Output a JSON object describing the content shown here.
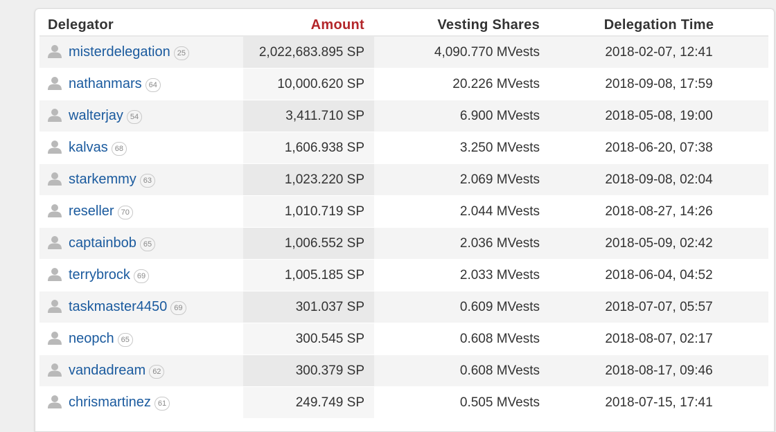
{
  "table": {
    "headers": {
      "delegator": "Delegator",
      "amount": "Amount",
      "vesting_shares": "Vesting Shares",
      "delegation_time": "Delegation Time"
    },
    "rows": [
      {
        "delegator": "misterdelegation",
        "rep": "25",
        "amount": "2,022,683.895 SP",
        "vesting": "4,090.770 MVests",
        "time": "2018-02-07, 12:41"
      },
      {
        "delegator": "nathanmars",
        "rep": "64",
        "amount": "10,000.620 SP",
        "vesting": "20.226 MVests",
        "time": "2018-09-08, 17:59"
      },
      {
        "delegator": "walterjay",
        "rep": "54",
        "amount": "3,411.710 SP",
        "vesting": "6.900 MVests",
        "time": "2018-05-08, 19:00"
      },
      {
        "delegator": "kalvas",
        "rep": "68",
        "amount": "1,606.938 SP",
        "vesting": "3.250 MVests",
        "time": "2018-06-20, 07:38"
      },
      {
        "delegator": "starkemmy",
        "rep": "63",
        "amount": "1,023.220 SP",
        "vesting": "2.069 MVests",
        "time": "2018-09-08, 02:04"
      },
      {
        "delegator": "reseller",
        "rep": "70",
        "amount": "1,010.719 SP",
        "vesting": "2.044 MVests",
        "time": "2018-08-27, 14:26"
      },
      {
        "delegator": "captainbob",
        "rep": "65",
        "amount": "1,006.552 SP",
        "vesting": "2.036 MVests",
        "time": "2018-05-09, 02:42"
      },
      {
        "delegator": "terrybrock",
        "rep": "69",
        "amount": "1,005.185 SP",
        "vesting": "2.033 MVests",
        "time": "2018-06-04, 04:52"
      },
      {
        "delegator": "taskmaster4450",
        "rep": "69",
        "amount": "301.037 SP",
        "vesting": "0.609 MVests",
        "time": "2018-07-07, 05:57"
      },
      {
        "delegator": "neopch",
        "rep": "65",
        "amount": "300.545 SP",
        "vesting": "0.608 MVests",
        "time": "2018-08-07, 02:17"
      },
      {
        "delegator": "vandadream",
        "rep": "62",
        "amount": "300.379 SP",
        "vesting": "0.608 MVests",
        "time": "2018-08-17, 09:46"
      },
      {
        "delegator": "chrismartinez",
        "rep": "61",
        "amount": "249.749 SP",
        "vesting": "0.505 MVests",
        "time": "2018-07-15, 17:41"
      }
    ]
  },
  "icons": {
    "avatar": "user-avatar-icon"
  },
  "colors": {
    "link": "#1a5a9e",
    "sorted_header": "#b3262a"
  }
}
